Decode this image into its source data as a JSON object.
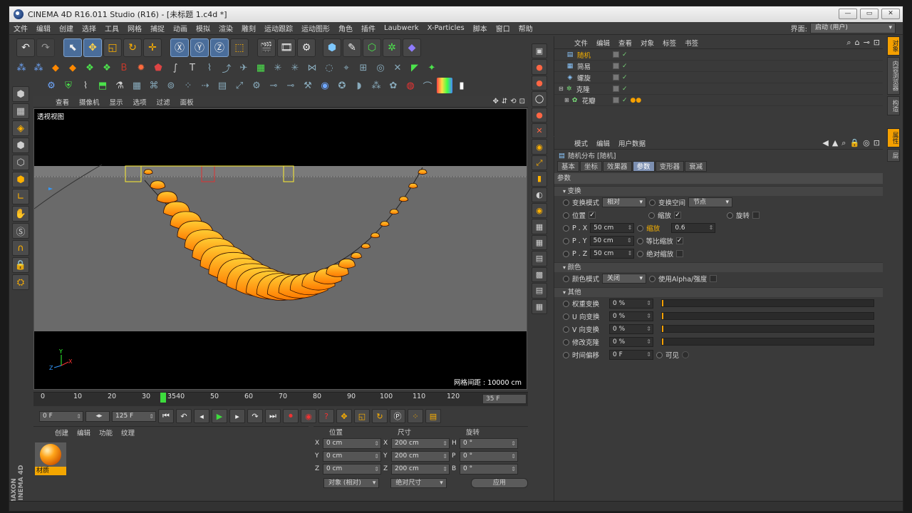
{
  "window": {
    "title": "CINEMA 4D R16.011 Studio (R16) - [未标题 1.c4d *]",
    "buttons": [
      "—",
      "▭",
      "✕"
    ]
  },
  "menubar": {
    "items": [
      "文件",
      "编辑",
      "创建",
      "选择",
      "工具",
      "网格",
      "捕捉",
      "动画",
      "模拟",
      "渲染",
      "雕刻",
      "运动跟踪",
      "运动图形",
      "角色",
      "插件",
      "Laubwerk",
      "X-Particles",
      "脚本",
      "窗口",
      "帮助"
    ],
    "interface_label": "界面:",
    "interface_value": "启动 (用户)"
  },
  "viewport": {
    "menu": [
      "查看",
      "摄像机",
      "显示",
      "选项",
      "过滤",
      "面板"
    ],
    "label": "透视视图",
    "grid_text": "网格间距 : 10000 cm"
  },
  "timeline": {
    "ticks": [
      "0",
      "10",
      "20",
      "30",
      "3540",
      "50",
      "60",
      "70",
      "80",
      "90",
      "100",
      "110",
      "120"
    ],
    "current_frame": "35 F",
    "start": "0 F",
    "end": "125 F"
  },
  "material": {
    "menu": [
      "创建",
      "编辑",
      "功能",
      "纹理"
    ],
    "name": "材质"
  },
  "brand": "MAXON CINEMA 4D",
  "coords": {
    "headers": [
      "位置",
      "尺寸",
      "旋转"
    ],
    "rows": [
      {
        "a": "X",
        "pos": "0 cm",
        "b": "X",
        "size": "200 cm",
        "c": "H",
        "rot": "0 °"
      },
      {
        "a": "Y",
        "pos": "0 cm",
        "b": "Y",
        "size": "200 cm",
        "c": "P",
        "rot": "0 °"
      },
      {
        "a": "Z",
        "pos": "0 cm",
        "b": "Z",
        "size": "200 cm",
        "c": "B",
        "rot": "0 °"
      }
    ],
    "mode": "对象 (相对)",
    "size_mode": "绝对尺寸",
    "apply": "应用"
  },
  "objmgr": {
    "menu": [
      "文件",
      "编辑",
      "查看",
      "对象",
      "标签",
      "书签"
    ],
    "objects": [
      {
        "icon": "▤",
        "name": "随机",
        "hl": true
      },
      {
        "icon": "▦",
        "name": "简易"
      },
      {
        "icon": "◈",
        "name": "螺旋"
      },
      {
        "icon": "✲",
        "name": "克隆"
      },
      {
        "icon": "✿",
        "name": "花瓣"
      }
    ]
  },
  "attr": {
    "menu": [
      "模式",
      "编辑",
      "用户数据"
    ],
    "title": "随机分布 [随机]",
    "tabs": [
      "基本",
      "坐标",
      "效果器",
      "参数",
      "变形器",
      "衰减"
    ],
    "active_tab": "参数",
    "section": "参数",
    "group_transform": "变换",
    "mode_label": "变换模式",
    "mode_value": "相对",
    "space_label": "变换空间",
    "space_value": "节点",
    "pos_label": "位置",
    "scale_label": "缩放",
    "rot_label": "旋转",
    "px_label": "P . X",
    "px": "50 cm",
    "py_label": "P . Y",
    "py": "50 cm",
    "pz_label": "P . Z",
    "pz": "50 cm",
    "scale2_label": "缩放",
    "scale2_value": "0.6",
    "uniform_label": "等比缩放",
    "abs_label": "绝对缩放",
    "group_color": "颜色",
    "colormode_label": "颜色模式",
    "colormode_value": "关闭",
    "alpha_label": "使用Alpha/强度",
    "group_other": "其他",
    "other": [
      {
        "label": "权重变换",
        "value": "0 %"
      },
      {
        "label": "U 向变换",
        "value": "0 %"
      },
      {
        "label": "V 向变换",
        "value": "0 %"
      },
      {
        "label": "修改克隆",
        "value": "0 %"
      },
      {
        "label": "时间偏移",
        "value": "0 F"
      }
    ],
    "visible_label": "可见"
  },
  "sidetabs": [
    "对象",
    "内容浏览器",
    "构造"
  ],
  "attr_sidetabs": [
    "属性",
    "层"
  ]
}
